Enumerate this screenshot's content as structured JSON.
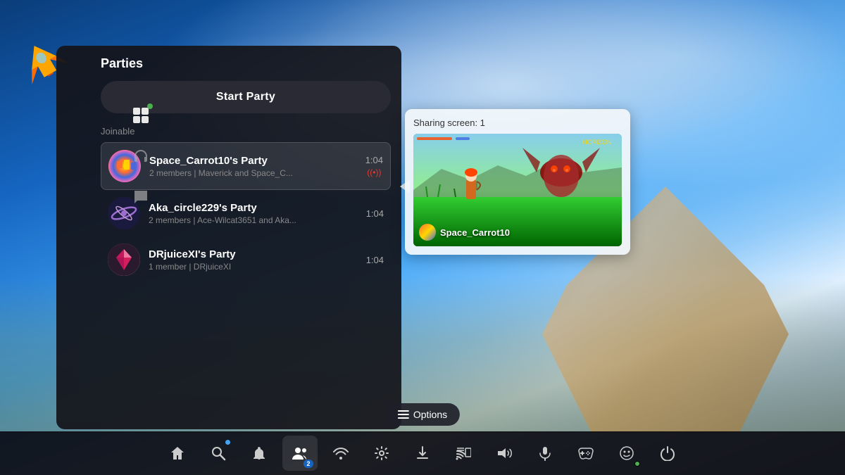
{
  "background": {
    "gradient_desc": "blue sky with clouds"
  },
  "sidebar": {
    "icons": [
      {
        "name": "parties-icon",
        "symbol": "⬛",
        "active": true,
        "dot": true
      },
      {
        "name": "headset-icon",
        "symbol": "🎧",
        "active": false,
        "dot": false
      },
      {
        "name": "chat-icon",
        "symbol": "💬",
        "active": false,
        "dot": false
      }
    ]
  },
  "panel": {
    "title": "Parties",
    "start_party_label": "Start Party",
    "joinable_label": "Joinable",
    "parties": [
      {
        "id": "space-carrot",
        "name": "Space_Carrot10's Party",
        "members": "2 members | Maverick and Space_C...",
        "time": "1:04",
        "live": true,
        "selected": true,
        "avatar_emoji": "🎲"
      },
      {
        "id": "aka-circle",
        "name": "Aka_circle229's Party",
        "members": "2 members | Ace-Wilcat3651 and Aka...",
        "time": "1:04",
        "live": false,
        "selected": false,
        "avatar_emoji": "🌀"
      },
      {
        "id": "drjuice",
        "name": "DRjuiceXI's Party",
        "members": "1 member | DRjuiceXI",
        "time": "1:04",
        "live": false,
        "selected": false,
        "avatar_emoji": "💎"
      }
    ]
  },
  "sharing_popup": {
    "label": "Sharing screen: 1",
    "username": "Space_Carrot10"
  },
  "options_button": {
    "label": "Options"
  },
  "taskbar": {
    "items": [
      {
        "name": "home",
        "symbol": "⌂",
        "badge": null,
        "active": false
      },
      {
        "name": "search",
        "symbol": "🔍",
        "badge": null,
        "active": false,
        "blue_dot": true
      },
      {
        "name": "notifications",
        "symbol": "🔔",
        "badge": null,
        "active": false
      },
      {
        "name": "friends",
        "symbol": "👥",
        "badge": "2",
        "active": true
      },
      {
        "name": "wifi",
        "symbol": "📶",
        "badge": null,
        "active": false
      },
      {
        "name": "settings",
        "symbol": "⚙",
        "badge": null,
        "active": false
      },
      {
        "name": "download",
        "symbol": "⬇",
        "badge": null,
        "active": false
      },
      {
        "name": "cast",
        "symbol": "📡",
        "badge": null,
        "active": false
      },
      {
        "name": "volume",
        "symbol": "🔊",
        "badge": null,
        "active": false
      },
      {
        "name": "mic",
        "symbol": "🎤",
        "badge": null,
        "active": false
      },
      {
        "name": "gamepad",
        "symbol": "🎮",
        "badge": null,
        "active": false
      },
      {
        "name": "emoji",
        "symbol": "😊",
        "badge": null,
        "active": false,
        "green_dot": true
      },
      {
        "name": "power",
        "symbol": "⏻",
        "badge": null,
        "active": false
      }
    ]
  }
}
